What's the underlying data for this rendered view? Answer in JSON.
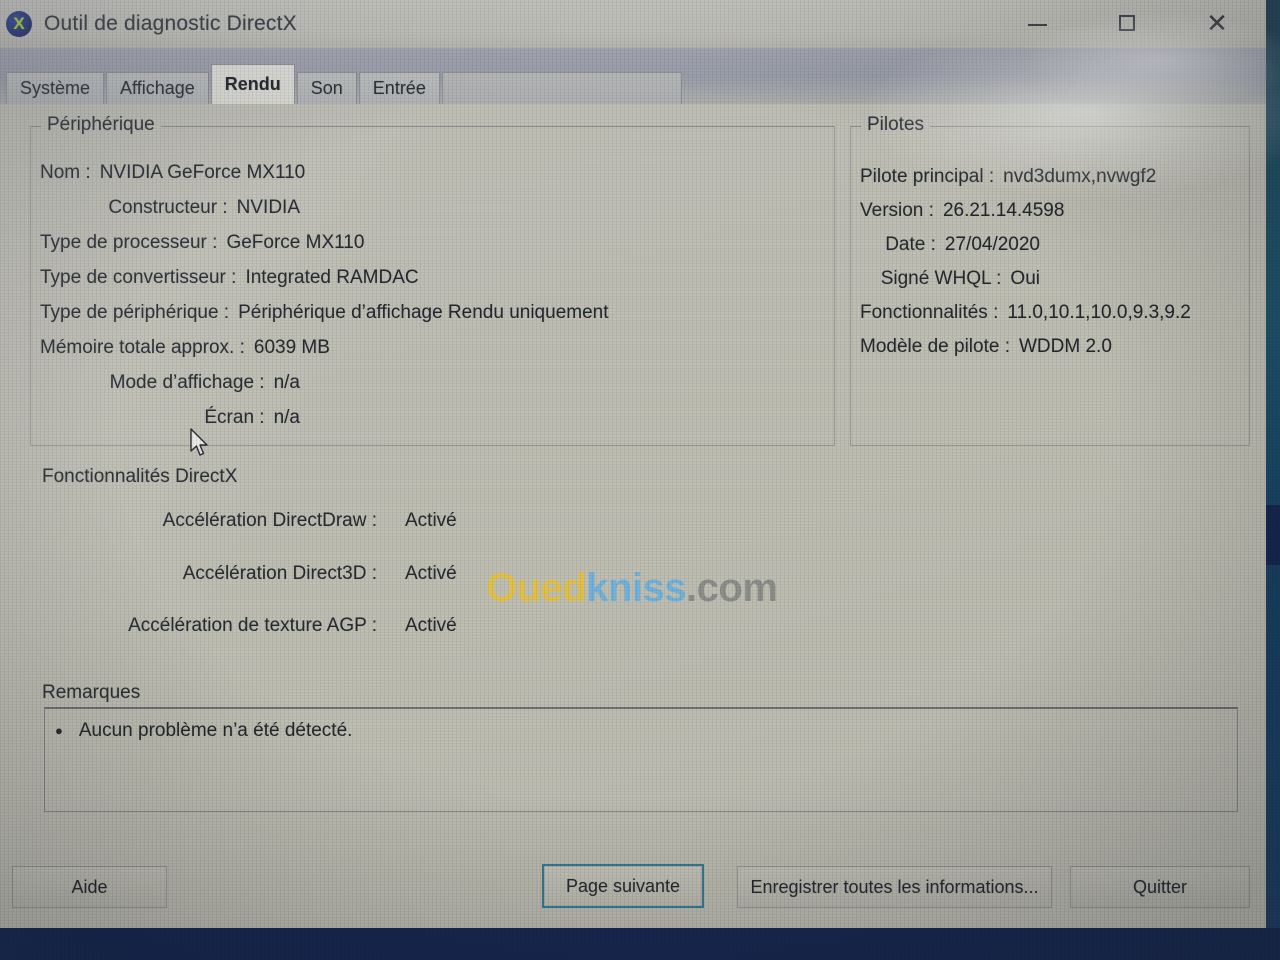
{
  "window": {
    "title": "Outil de diagnostic DirectX",
    "icon": "directx-logo-icon",
    "controls": {
      "minimize": "minimize-icon",
      "maximize": "maximize-icon",
      "close": "close-icon"
    }
  },
  "tabs": [
    {
      "label": "Système",
      "active": false
    },
    {
      "label": "Affichage",
      "active": false
    },
    {
      "label": "Rendu",
      "active": true
    },
    {
      "label": "Son",
      "active": false
    },
    {
      "label": "Entrée",
      "active": false
    }
  ],
  "device": {
    "legend": "Périphérique",
    "rows": [
      {
        "label": "Nom :",
        "value": "NVIDIA GeForce MX110"
      },
      {
        "label": "Constructeur :",
        "value": "NVIDIA"
      },
      {
        "label": "Type de processeur :",
        "value": "GeForce MX110"
      },
      {
        "label": "Type de convertisseur :",
        "value": "Integrated RAMDAC"
      },
      {
        "label": "Type de périphérique :",
        "value": "Périphérique d’affichage Rendu uniquement"
      },
      {
        "label": "Mémoire totale approx. :",
        "value": "6039 MB"
      },
      {
        "label": "Mode d’affichage :",
        "value": "n/a"
      },
      {
        "label": "Écran :",
        "value": "n/a"
      }
    ]
  },
  "drivers": {
    "legend": "Pilotes",
    "rows": [
      {
        "label": "Pilote principal :",
        "value": "nvd3dumx,nvwgf2"
      },
      {
        "label": "Version :",
        "value": "26.21.14.4598"
      },
      {
        "label": "Date :",
        "value": "27/04/2020"
      },
      {
        "label": "Signé WHQL :",
        "value": "Oui"
      },
      {
        "label": "Fonctionnalités :",
        "value": "11.0,10.1,10.0,9.3,9.2"
      },
      {
        "label": "Modèle de pilote :",
        "value": "WDDM 2.0"
      }
    ]
  },
  "directx_features": {
    "title": "Fonctionnalités DirectX",
    "rows": [
      {
        "label": "Accélération DirectDraw :",
        "value": "Activé"
      },
      {
        "label": "Accélération Direct3D :",
        "value": "Activé"
      },
      {
        "label": "Accélération de texture AGP :",
        "value": "Activé"
      }
    ]
  },
  "remarks": {
    "title": "Remarques",
    "items": [
      "Aucun problème n’a été détecté."
    ]
  },
  "buttons": {
    "help": "Aide",
    "next_page": "Page suivante",
    "save_all": "Enregistrer toutes les informations...",
    "quit": "Quitter"
  },
  "watermark": {
    "part1": "Oued",
    "part2": "kniss",
    "part3": ".com",
    "color1": "#f0c93e",
    "color2": "#6cb8e8",
    "color3": "#8b8d8a"
  },
  "colors": {
    "window_bg": "#c5c4b9",
    "titlebar": "#cbcac1",
    "tab_active": "#e7e6de",
    "taskbar": "#0d1f4f",
    "focus_border": "#2d7d97"
  }
}
